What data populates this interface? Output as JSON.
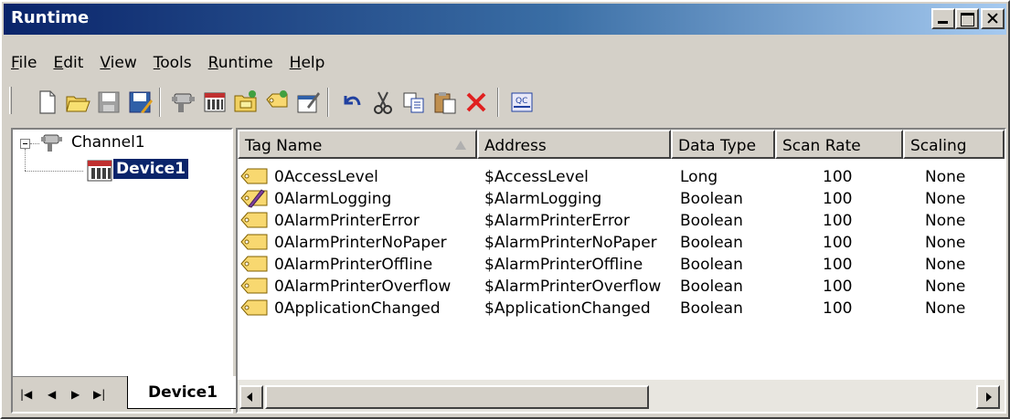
{
  "window": {
    "title": "Runtime"
  },
  "menu": [
    {
      "key": "F",
      "rest": "ile"
    },
    {
      "key": "E",
      "rest": "dit"
    },
    {
      "key": "V",
      "rest": "iew"
    },
    {
      "key": "T",
      "rest": "ools"
    },
    {
      "key": "R",
      "rest": "untime"
    },
    {
      "key": "H",
      "rest": "elp"
    }
  ],
  "toolbar": {
    "icons": [
      "new-icon",
      "open-icon",
      "save-icon",
      "save-as-icon",
      "new-channel-icon",
      "new-device-icon",
      "new-tag-group-icon",
      "new-tag-icon",
      "properties-icon",
      "undo-icon",
      "cut-icon",
      "copy-icon",
      "paste-icon",
      "delete-icon",
      "quick-client-icon"
    ],
    "qc_label": "QC"
  },
  "tree": {
    "channel": "Channel1",
    "device": "Device1"
  },
  "tabs": {
    "nav": [
      "|◀",
      "◀",
      "▶",
      "▶|"
    ],
    "active": "Device1"
  },
  "columns": [
    "Tag Name",
    "Address",
    "Data Type",
    "Scan Rate",
    "Scaling"
  ],
  "rows": [
    {
      "icon": "tag-icon",
      "name": "0AccessLevel",
      "address": "$AccessLevel",
      "type": "Long",
      "scan": "100",
      "scaling": "None"
    },
    {
      "icon": "tag-writable-icon",
      "name": "0AlarmLogging",
      "address": "$AlarmLogging",
      "type": "Boolean",
      "scan": "100",
      "scaling": "None"
    },
    {
      "icon": "tag-icon",
      "name": "0AlarmPrinterError",
      "address": "$AlarmPrinterError",
      "type": "Boolean",
      "scan": "100",
      "scaling": "None"
    },
    {
      "icon": "tag-icon",
      "name": "0AlarmPrinterNoPaper",
      "address": "$AlarmPrinterNoPaper",
      "type": "Boolean",
      "scan": "100",
      "scaling": "None"
    },
    {
      "icon": "tag-icon",
      "name": "0AlarmPrinterOffline",
      "address": "$AlarmPrinterOffline",
      "type": "Boolean",
      "scan": "100",
      "scaling": "None"
    },
    {
      "icon": "tag-icon",
      "name": "0AlarmPrinterOverflow",
      "address": "$AlarmPrinterOverflow",
      "type": "Boolean",
      "scan": "100",
      "scaling": "None"
    },
    {
      "icon": "tag-icon",
      "name": "0ApplicationChanged",
      "address": "$ApplicationChanged",
      "type": "Boolean",
      "scan": "100",
      "scaling": "None"
    }
  ],
  "colors": {
    "title_start": "#0a246a",
    "title_end": "#a6caf0",
    "selection": "#0a246a",
    "tag_yellow": "#f8d870"
  }
}
